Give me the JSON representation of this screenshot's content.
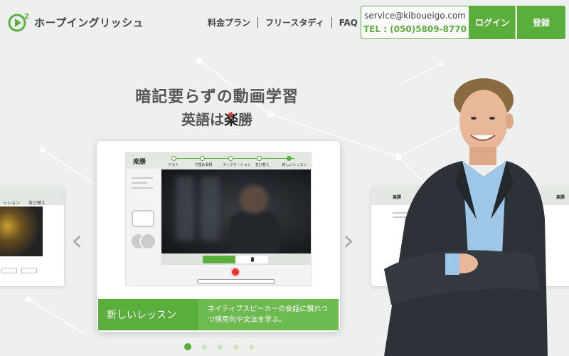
{
  "brand": {
    "name": "ホープイングリッシュ",
    "mark_sup": "2"
  },
  "nav": {
    "items": [
      {
        "label": "料金プラン"
      },
      {
        "label": "フリースタディ"
      },
      {
        "label": "FAQ"
      }
    ]
  },
  "contact": {
    "email": "service@kiboueigo.com",
    "tel": "TEL : (050)5809-8770"
  },
  "auth": {
    "login_label": "ログイン",
    "register_label": "登録"
  },
  "hero": {
    "headline": "暗記要らずの動画学習",
    "subhead_prefix": "英語は",
    "subhead_raku": "楽",
    "subhead_suffix": "勝"
  },
  "slide": {
    "app_label": "楽勝",
    "steps": [
      "テスト",
      "穴埋め問題",
      "ディクテーション",
      "並び替え",
      "新しいレッスン"
    ],
    "active_step": 4,
    "caption_title": "新しいレッスン",
    "caption_desc": "ネイティブスピーカーの会話に慣れつつ慣用句や文法を学ぶ。"
  },
  "side_slides": {
    "left_label": "ッション",
    "left_label2": "並び替え",
    "right_label": "楽勝",
    "right2_label": "楽勝"
  },
  "carousel": {
    "total": 5,
    "active": 0
  },
  "colors": {
    "accent": "#5aae3c",
    "record": "#e33333"
  },
  "icons": {
    "prev": "chevron-left-icon",
    "next": "chevron-right-icon",
    "logo": "play-circle-logo-icon"
  }
}
